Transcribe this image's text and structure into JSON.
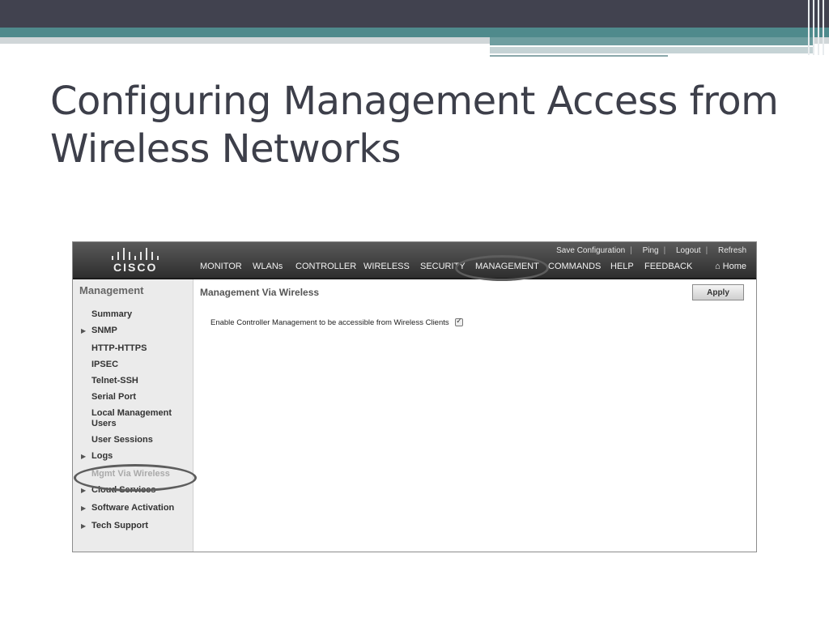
{
  "slide": {
    "title_line1": "Configuring Management Access from",
    "title_line2": "Wireless Networks"
  },
  "controller": {
    "logo_text": "CISCO",
    "top_links": [
      "Save Configuration",
      "Ping",
      "Logout",
      "Refresh"
    ],
    "nav": [
      "MONITOR",
      "WLANs",
      "CONTROLLER",
      "WIRELESS",
      "SECURITY",
      "MANAGEMENT",
      "COMMANDS",
      "HELP",
      "FEEDBACK"
    ],
    "home_label": "Home",
    "active_nav": "MANAGEMENT",
    "sidebar": {
      "title": "Management",
      "items": [
        {
          "label": "Summary",
          "expandable": false
        },
        {
          "label": "SNMP",
          "expandable": true
        },
        {
          "label": "HTTP-HTTPS",
          "expandable": false
        },
        {
          "label": "IPSEC",
          "expandable": false
        },
        {
          "label": "Telnet-SSH",
          "expandable": false
        },
        {
          "label": "Serial Port",
          "expandable": false
        },
        {
          "label": "Local Management Users",
          "expandable": false
        },
        {
          "label": "User Sessions",
          "expandable": false
        },
        {
          "label": "Logs",
          "expandable": true
        },
        {
          "label": "Mgmt Via Wireless",
          "expandable": false,
          "selected": true
        },
        {
          "label": "Cloud Services",
          "expandable": true
        },
        {
          "label": "Software Activation",
          "expandable": true
        },
        {
          "label": "Tech Support",
          "expandable": true
        }
      ]
    },
    "content": {
      "title": "Management Via Wireless",
      "apply_label": "Apply",
      "enable_label": "Enable Controller Management to be accessible from Wireless Clients",
      "enable_checked": true
    }
  },
  "colors": {
    "slide_title": "#3d3f4a",
    "header_dark": "#41424f",
    "header_teal": "#4f8a8c"
  }
}
